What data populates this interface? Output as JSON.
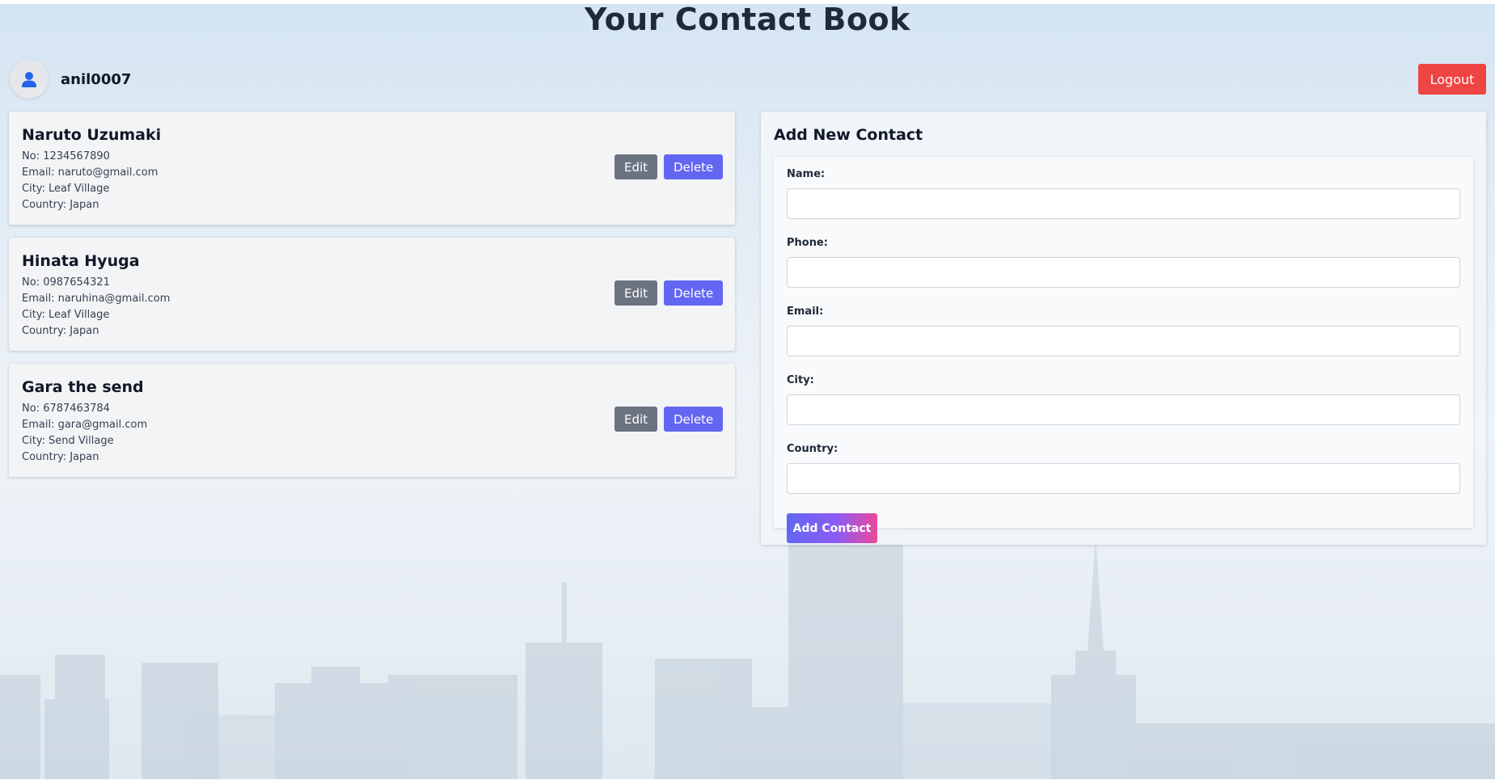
{
  "app": {
    "title": "Your Contact Book"
  },
  "user": {
    "username": "anil0007",
    "avatar_icon": "user-icon"
  },
  "header": {
    "logout_label": "Logout"
  },
  "contacts": [
    {
      "name": "Naruto Uzumaki",
      "phone": "No: 1234567890",
      "email": "Email: naruto@gmail.com",
      "city": "City: Leaf Village",
      "country": "Country: Japan"
    },
    {
      "name": "Hinata Hyuga",
      "phone": "No: 0987654321",
      "email": "Email: naruhina@gmail.com",
      "city": "City: Leaf Village",
      "country": "Country: Japan"
    },
    {
      "name": "Gara the send",
      "phone": "No: 6787463784",
      "email": "Email: gara@gmail.com",
      "city": "City: Send Village",
      "country": "Country: Japan"
    }
  ],
  "card_actions": {
    "edit_label": "Edit",
    "delete_label": "Delete"
  },
  "add_form": {
    "title": "Add New Contact",
    "name_label": "Name:",
    "name_value": "",
    "phone_label": "Phone:",
    "phone_value": "",
    "email_label": "Email:",
    "email_value": "",
    "city_label": "City:",
    "city_value": "",
    "country_label": "Country:",
    "country_value": "",
    "submit_label": "Add Contact"
  },
  "colors": {
    "logout": "#ef4444",
    "edit": "#6b7280",
    "delete": "#6366f1",
    "add_gradient_start": "#6366f1",
    "add_gradient_end": "#ec4899"
  }
}
